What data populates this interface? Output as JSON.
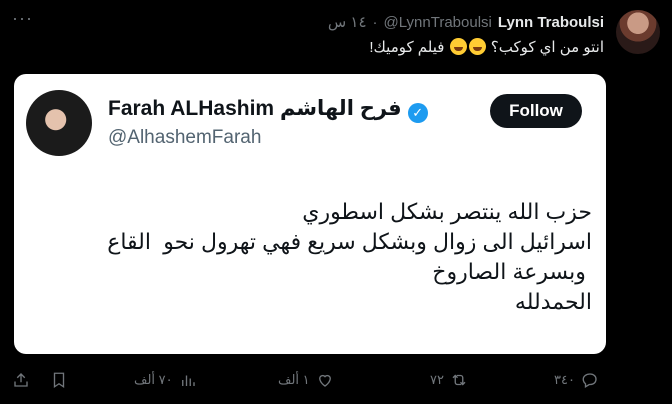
{
  "tweet": {
    "author_name": "Lynn Traboulsi",
    "author_handle": "@LynnTraboulsi",
    "separator": "·",
    "time": "١٤ س",
    "text_part1": "انتو من اي كوكب؟ ",
    "text_part2": " فيلم كوميك!"
  },
  "quote": {
    "name": "Farah ALHashim فرح الهاشم",
    "handle": "@AlhashemFarah",
    "follow_label": "Follow",
    "lines": [
      "حزب الله ينتصر بشكل اسطوري",
      "اسرائيل الى زوال وبشكل سريع فهي تهرول نحو  القاع",
      " وبسرعة الصاروخ",
      "الحمدلله"
    ]
  },
  "actions": {
    "replies": "٣٤٠",
    "reposts": "٧٢",
    "likes": "١ ألف",
    "views": "٧٠ ألف"
  },
  "icons": [
    "more-icon",
    "laughing-emoji-icon",
    "verified-icon",
    "reply-icon",
    "repost-icon",
    "like-icon",
    "views-icon",
    "bookmark-icon",
    "share-icon"
  ],
  "colors": {
    "background": "#000000",
    "muted": "#71767b",
    "verified_blue": "#1d9bf0",
    "card": "#ffffff"
  }
}
